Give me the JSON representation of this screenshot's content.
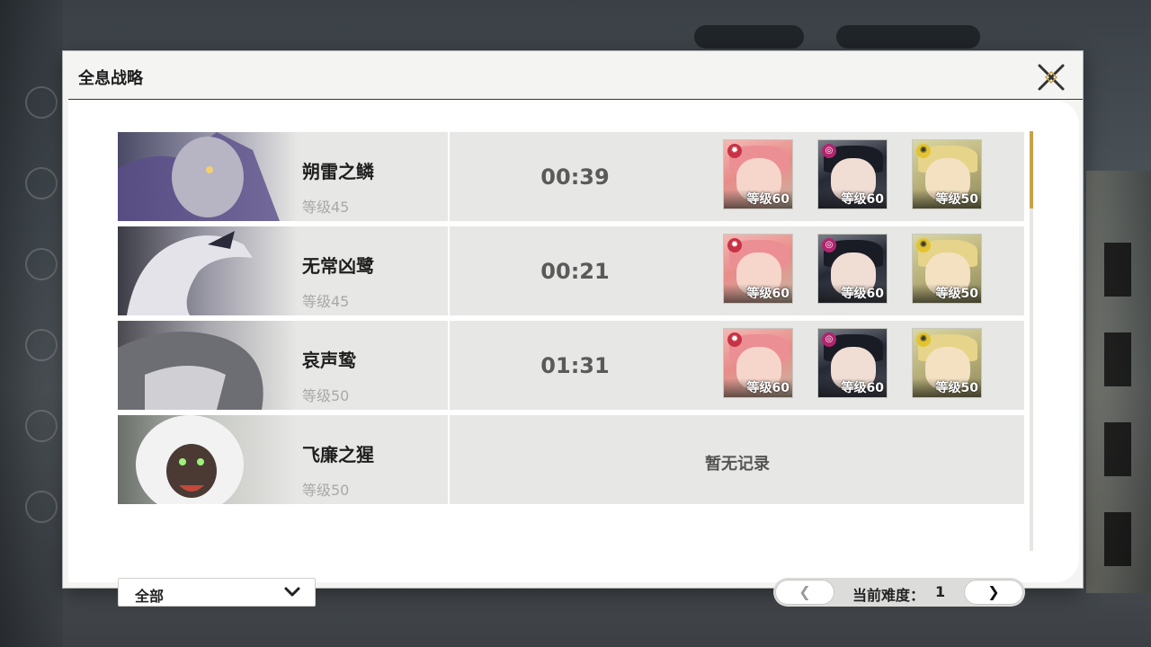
{
  "dialog": {
    "title": "全息战略",
    "bosses": [
      {
        "name": "朔雷之鳞",
        "level": "等级45",
        "time": "00:39",
        "team": [
          {
            "level": "等级60"
          },
          {
            "level": "等级60"
          },
          {
            "level": "等级50"
          }
        ]
      },
      {
        "name": "无常凶鹭",
        "level": "等级45",
        "time": "00:21",
        "team": [
          {
            "level": "等级60"
          },
          {
            "level": "等级60"
          },
          {
            "level": "等级50"
          }
        ]
      },
      {
        "name": "哀声鸷",
        "level": "等级50",
        "time": "01:31",
        "team": [
          {
            "level": "等级60"
          },
          {
            "level": "等级60"
          },
          {
            "level": "等级50"
          }
        ]
      },
      {
        "name": "飞廉之猩",
        "level": "等级50",
        "no_record": "暂无记录"
      }
    ],
    "filter": {
      "selected": "全部"
    },
    "pager": {
      "prev": "❮",
      "next": "❯",
      "label": "当前难度：",
      "value": "1"
    }
  },
  "icons": {
    "close": "close-icon",
    "chevron": "chevron-down-icon",
    "elements": [
      "fusion-element-icon",
      "havoc-element-icon",
      "spectro-element-icon"
    ]
  },
  "colors": {
    "accent": "#c7a24a",
    "panel": "#f4f4f2",
    "row": "#e7e7e5"
  }
}
